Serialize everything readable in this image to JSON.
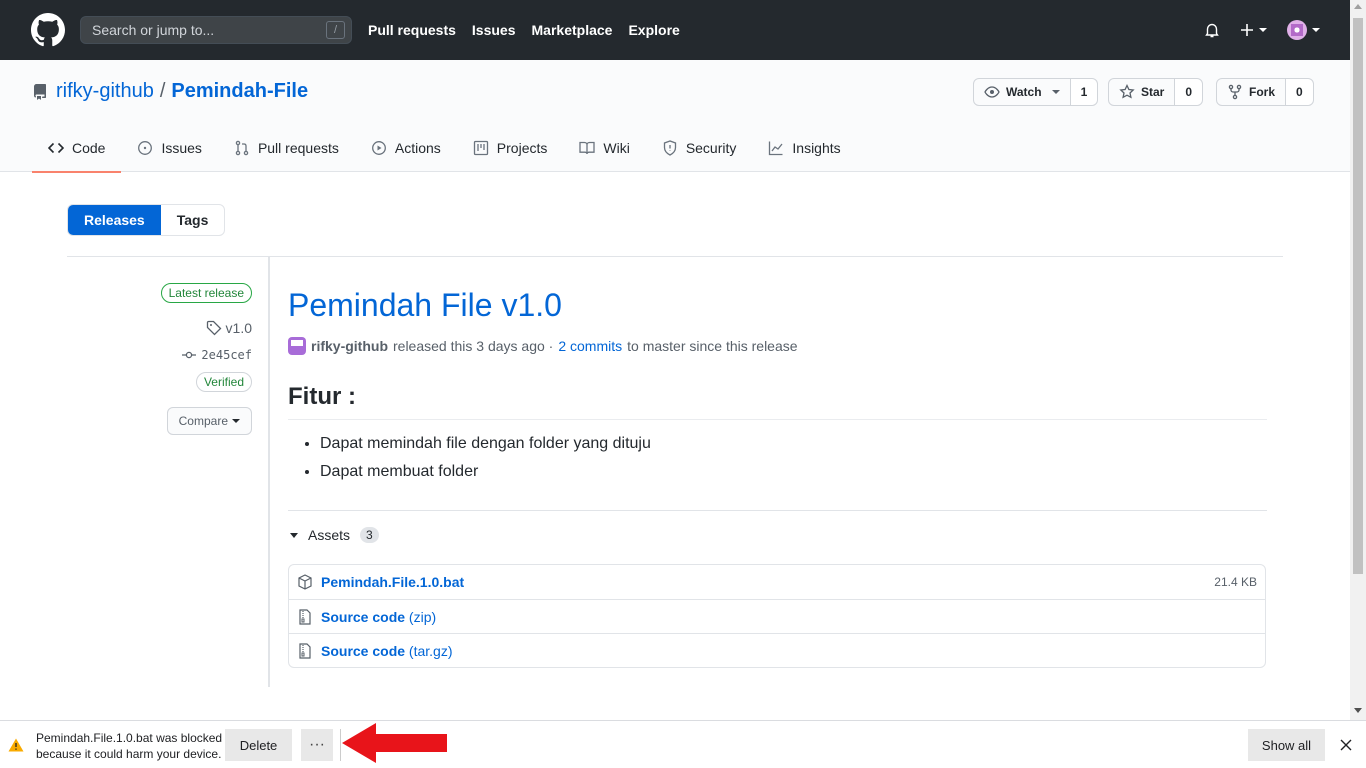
{
  "header": {
    "search_placeholder": "Search or jump to...",
    "search_shortcut": "/",
    "nav": [
      "Pull requests",
      "Issues",
      "Marketplace",
      "Explore"
    ]
  },
  "repo": {
    "owner": "rifky-github",
    "separator": "/",
    "name": "Pemindah-File",
    "watch_label": "Watch",
    "watch_count": "1",
    "star_label": "Star",
    "star_count": "0",
    "fork_label": "Fork",
    "fork_count": "0",
    "tabs": [
      {
        "label": "Code",
        "icon": "code-icon"
      },
      {
        "label": "Issues",
        "icon": "issue-icon"
      },
      {
        "label": "Pull requests",
        "icon": "pull-request-icon"
      },
      {
        "label": "Actions",
        "icon": "play-icon"
      },
      {
        "label": "Projects",
        "icon": "project-icon"
      },
      {
        "label": "Wiki",
        "icon": "book-icon"
      },
      {
        "label": "Security",
        "icon": "shield-icon"
      },
      {
        "label": "Insights",
        "icon": "graph-icon"
      }
    ]
  },
  "subnav": {
    "releases": "Releases",
    "tags": "Tags"
  },
  "release_meta": {
    "latest": "Latest release",
    "tag": "v1.0",
    "commit": "2e45cef",
    "verified": "Verified",
    "compare": "Compare"
  },
  "release": {
    "title": "Pemindah File v1.0",
    "author": "rifky-github",
    "released_text": "released this 3 days ago ·",
    "commits_link": "2 commits",
    "commits_suffix": "to master since this release",
    "heading": "Fitur :",
    "bullets": [
      "Dapat memindah file dengan folder yang dituju",
      "Dapat membuat folder"
    ],
    "assets_label": "Assets",
    "assets_count": "3",
    "assets": [
      {
        "name": "Pemindah.File.1.0.bat",
        "size": "21.4 KB"
      },
      {
        "name": "Source code",
        "suffix": "(zip)"
      },
      {
        "name": "Source code",
        "suffix": "(tar.gz)"
      }
    ]
  },
  "download_bar": {
    "line1": "Pemindah.File.1.0.bat was blocked",
    "line2": "because it could harm your device.",
    "delete": "Delete",
    "more": "···",
    "show_all": "Show all",
    "colors": {
      "warning": "#f9ab00",
      "arrow": "#e8141a"
    }
  }
}
